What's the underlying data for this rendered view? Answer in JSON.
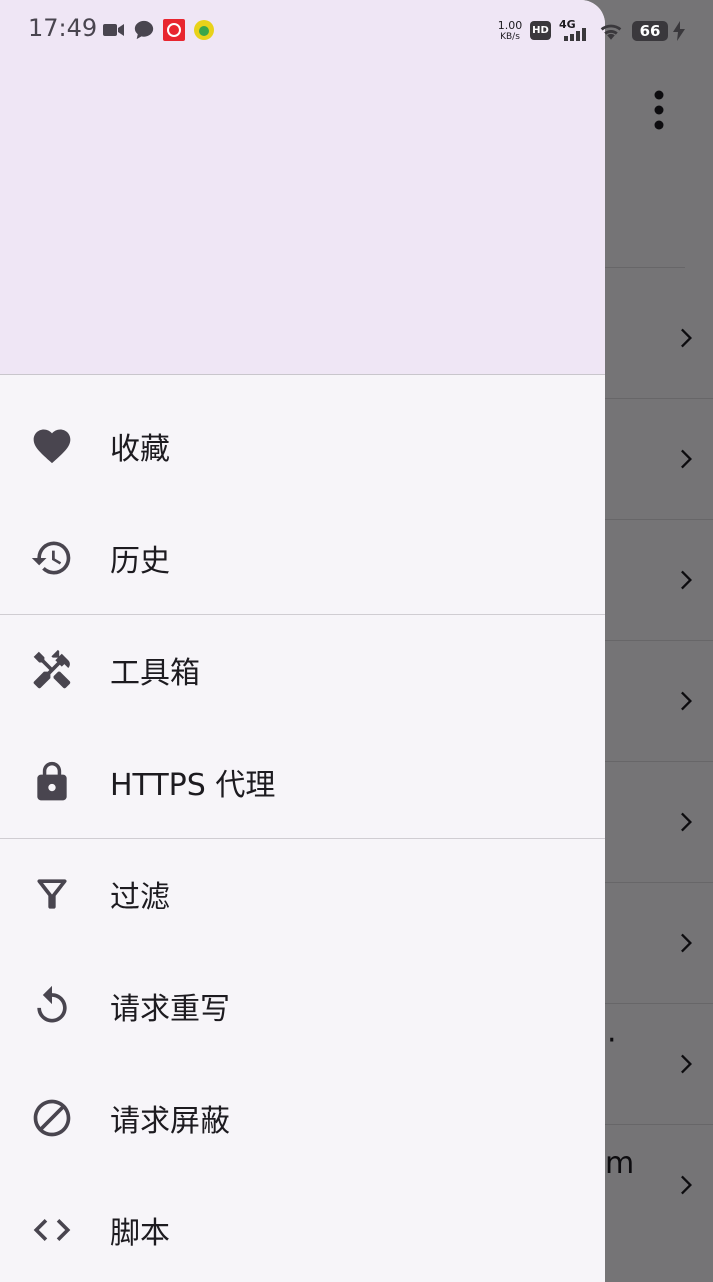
{
  "status_bar": {
    "time": "17:49",
    "net_speed_value": "1.00",
    "net_speed_unit": "KB/s",
    "hd_badge": "HD",
    "network_type": "4G",
    "battery": "66",
    "icons": [
      "video-camera-icon",
      "chat-bubble-icon",
      "red-app-icon",
      "yellow-app-icon",
      "hd-icon",
      "signal-icon",
      "wifi-icon",
      "battery-icon",
      "charging-icon"
    ]
  },
  "background_app": {
    "fragment_1": "·",
    "fragment_2": "m"
  },
  "drawer": {
    "groups": [
      [
        {
          "label": "收藏",
          "icon": "heart-icon"
        },
        {
          "label": "历史",
          "icon": "history-icon"
        }
      ],
      [
        {
          "label": "工具箱",
          "icon": "tools-icon"
        },
        {
          "label": "HTTPS 代理",
          "icon": "lock-icon"
        }
      ],
      [
        {
          "label": "过滤",
          "icon": "filter-icon"
        },
        {
          "label": "请求重写",
          "icon": "rewrite-icon"
        },
        {
          "label": "请求屏蔽",
          "icon": "block-icon"
        },
        {
          "label": "脚本",
          "icon": "code-icon"
        }
      ]
    ]
  },
  "colors": {
    "drawer_header": "#efe6f5",
    "drawer_bg": "#f7f5f9",
    "icon": "#49454f",
    "text": "#1d1b20"
  }
}
